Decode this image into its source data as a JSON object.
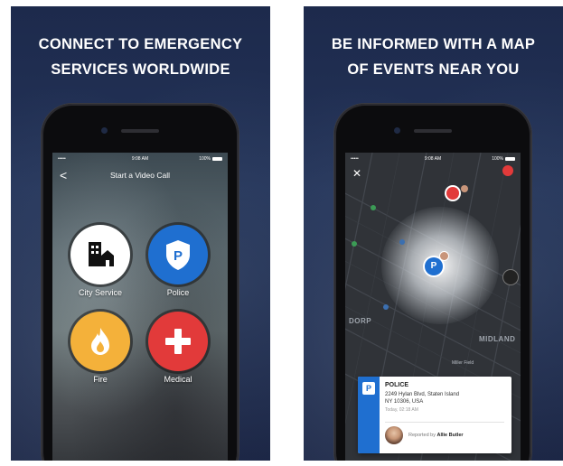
{
  "left_panel": {
    "headline_line1": "CONNECT TO EMERGENCY",
    "headline_line2": "SERVICES WORLDWIDE",
    "status": {
      "signal": "•••••",
      "time": "9:08 AM",
      "battery": "100%"
    },
    "nav": {
      "back": "<",
      "title": "Start a Video Call"
    },
    "services": [
      {
        "label": "City Service",
        "icon": "building-icon",
        "color": "#ffffff"
      },
      {
        "label": "Police",
        "icon": "police-badge-icon",
        "color": "#1f6fd0"
      },
      {
        "label": "Fire",
        "icon": "flame-icon",
        "color": "#f4b13a"
      },
      {
        "label": "Medical",
        "icon": "medical-cross-icon",
        "color": "#e23a3a"
      }
    ]
  },
  "right_panel": {
    "headline_line1": "BE INFORMED WITH A MAP",
    "headline_line2": "OF EVENTS NEAR YOU",
    "status": {
      "signal": "•••••",
      "time": "9:08 AM",
      "battery": "100%"
    },
    "close": "✕",
    "map_labels": {
      "dorp": "DORP",
      "midland": "MIDLAND",
      "miller": "Miller Field"
    },
    "card": {
      "badge": "P",
      "type": "POLICE",
      "address_line1": "2249 Hylan Blvd, Staten Island",
      "address_line2": "NY 10306, USA",
      "time": "Today, 02:18 AM",
      "reported_prefix": "Reported by",
      "reporter": "Allie Butler"
    }
  },
  "colors": {
    "background": "#1d2a4c",
    "police_blue": "#1f6fd0",
    "fire_yellow": "#f4b13a",
    "medical_red": "#e23a3a"
  }
}
